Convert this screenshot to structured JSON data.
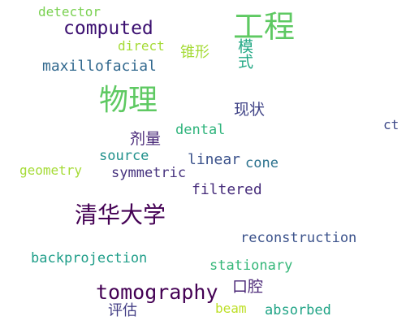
{
  "words": [
    {
      "id": "w0",
      "text": "detector",
      "color": "#7ad151",
      "font": "mono"
    },
    {
      "id": "w1",
      "text": "computed",
      "color": "#3b0f70",
      "font": "mono"
    },
    {
      "id": "w2",
      "text": "工程",
      "color": "#5ec962",
      "font": "cjk"
    },
    {
      "id": "w3",
      "text": "direct",
      "color": "#a5db36",
      "font": "mono"
    },
    {
      "id": "w4",
      "text": "锥形",
      "color": "#a5db36",
      "font": "cjk"
    },
    {
      "id": "w5",
      "text": "模式",
      "color": "#22a884",
      "font": "cjk",
      "vertical": true
    },
    {
      "id": "w6",
      "text": "maxillofacial",
      "color": "#31688e",
      "font": "mono"
    },
    {
      "id": "w7",
      "text": "物理",
      "color": "#5ec962",
      "font": "cjk"
    },
    {
      "id": "w8",
      "text": "现状",
      "color": "#414487",
      "font": "cjk"
    },
    {
      "id": "w9",
      "text": "ct",
      "color": "#3e4a89",
      "font": "mono"
    },
    {
      "id": "w10",
      "text": "dental",
      "color": "#2fb47c",
      "font": "mono"
    },
    {
      "id": "w11",
      "text": "剂量",
      "color": "#482878",
      "font": "cjk"
    },
    {
      "id": "w12",
      "text": "source",
      "color": "#21918c",
      "font": "mono"
    },
    {
      "id": "w13",
      "text": "linear",
      "color": "#3b528b",
      "font": "mono"
    },
    {
      "id": "w14",
      "text": "cone",
      "color": "#2c728e",
      "font": "mono"
    },
    {
      "id": "w15",
      "text": "geometry",
      "color": "#a5db36",
      "font": "mono"
    },
    {
      "id": "w16",
      "text": "symmetric",
      "color": "#46327e",
      "font": "mono"
    },
    {
      "id": "w17",
      "text": "filtered",
      "color": "#472d7b",
      "font": "mono"
    },
    {
      "id": "w18",
      "text": "清华大学",
      "color": "#440154",
      "font": "cjk"
    },
    {
      "id": "w19",
      "text": "reconstruction",
      "color": "#3b528b",
      "font": "mono"
    },
    {
      "id": "w20",
      "text": "backprojection",
      "color": "#1f9e89",
      "font": "mono"
    },
    {
      "id": "w21",
      "text": "stationary",
      "color": "#35b779",
      "font": "mono"
    },
    {
      "id": "w22",
      "text": "口腔",
      "color": "#482475",
      "font": "cjk"
    },
    {
      "id": "w23",
      "text": "tomography",
      "color": "#440154",
      "font": "mono"
    },
    {
      "id": "w24",
      "text": "beam",
      "color": "#bddf26",
      "font": "mono"
    },
    {
      "id": "w25",
      "text": "评估",
      "color": "#433e85",
      "font": "cjk"
    },
    {
      "id": "w26",
      "text": "absorbed",
      "color": "#20a486",
      "font": "mono"
    }
  ]
}
